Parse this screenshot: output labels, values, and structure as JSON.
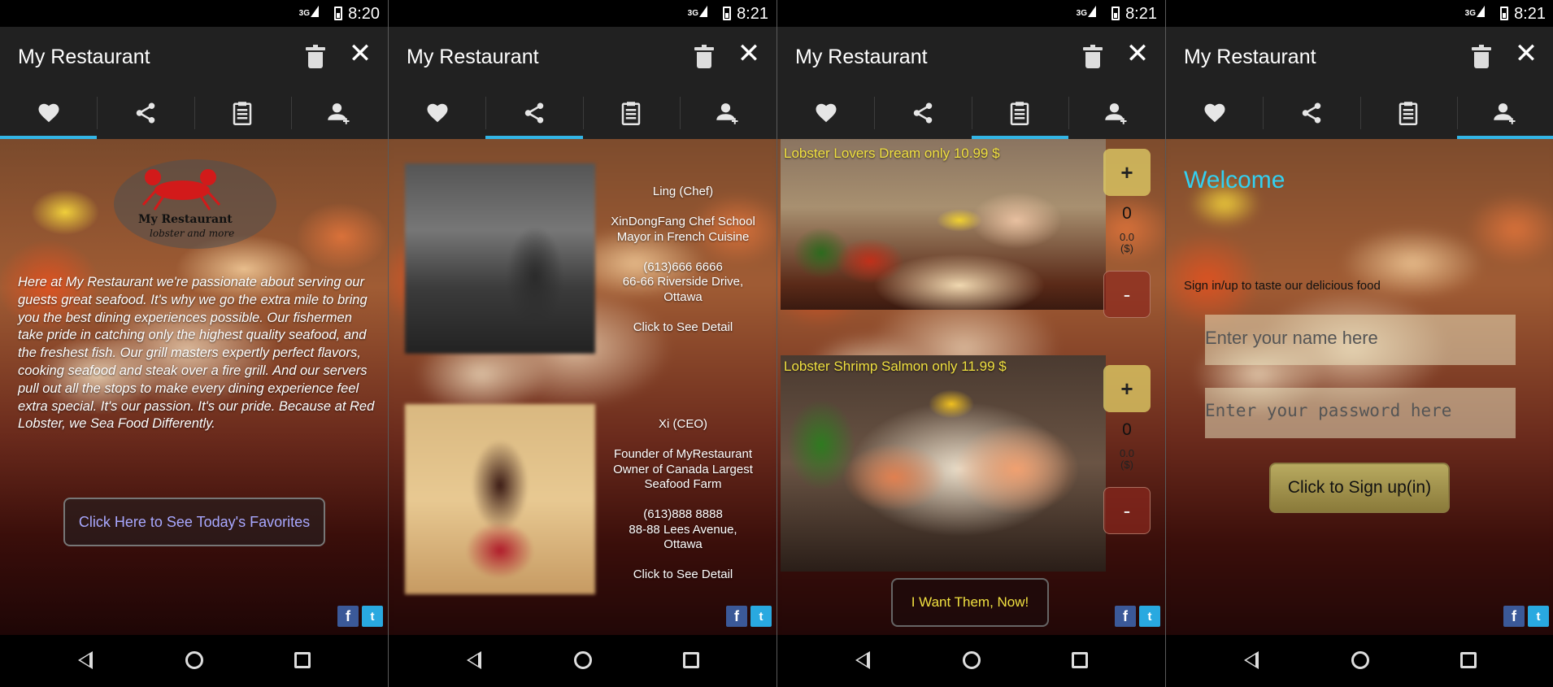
{
  "screens": [
    {
      "status": {
        "network": "3G",
        "time": "8:20"
      },
      "app_title": "My Restaurant",
      "active_tab": "favorites",
      "logo": {
        "name": "My Restaurant",
        "tagline": "lobster and more"
      },
      "about_text": "Here at My Restaurant we're passionate about serving our guests great seafood. It's why we go the extra mile to bring you the best dining experiences possible. Our fishermen take pride in catching only the highest quality seafood, and the freshest fish. Our grill masters expertly perfect flavors, cooking seafood and steak over a fire grill. And our servers pull out all the stops to make every dining experience feel extra special. It's our passion. It's our pride. Because at Red Lobster, we Sea Food Differently.",
      "button_label": "Click Here to See Today's Favorites"
    },
    {
      "status": {
        "network": "3G",
        "time": "8:21"
      },
      "app_title": "My Restaurant",
      "active_tab": "share",
      "people": [
        {
          "name": "Ling (Chef)",
          "desc": [
            "XinDongFang Chef School",
            "Mayor in French Cuisine"
          ],
          "phone": "(613)666 6666",
          "address": [
            "66-66 Riverside Drive,",
            "Ottawa"
          ],
          "link": "Click to See Detail"
        },
        {
          "name": "Xi (CEO)",
          "desc": [
            "Founder of MyRestaurant",
            "Owner of Canada Largest",
            "Seafood Farm"
          ],
          "phone": "(613)888 8888",
          "address": [
            "88-88 Lees Avenue,",
            "Ottawa"
          ],
          "link": "Click to See Detail"
        }
      ]
    },
    {
      "status": {
        "network": "3G",
        "time": "8:21"
      },
      "app_title": "My Restaurant",
      "active_tab": "menu",
      "dishes": [
        {
          "label": "Lobster Lovers Dream only 10.99 $",
          "qty": "0",
          "price": "0.0",
          "currency": "($)",
          "plus": "+",
          "minus": "-"
        },
        {
          "label": "Lobster Shrimp Salmon only 11.99 $",
          "qty": "0",
          "price": "0.0",
          "currency": "($)",
          "plus": "+",
          "minus": "-"
        }
      ],
      "button_label": "I Want Them, Now!"
    },
    {
      "status": {
        "network": "3G",
        "time": "8:21"
      },
      "app_title": "My Restaurant",
      "active_tab": "account",
      "welcome": "Welcome",
      "subtitle": "Sign in/up to taste our delicious food",
      "name_placeholder": "Enter your name here",
      "password_placeholder": "Enter your password here",
      "button_label": "Click to Sign up(in)"
    }
  ],
  "social": {
    "facebook": "f",
    "twitter": "t"
  },
  "icons": {
    "tabs": [
      "heart-icon",
      "share-icon",
      "clipboard-icon",
      "add-person-icon"
    ],
    "appbar": [
      "trash-icon",
      "close-icon"
    ],
    "nav": [
      "back-icon",
      "home-icon",
      "recents-icon"
    ]
  },
  "colors": {
    "tab_indicator": "#33b5e5",
    "welcome": "#33d0f0",
    "dish_label": "#f0e040",
    "fav_button_text": "#a8a8ff"
  }
}
